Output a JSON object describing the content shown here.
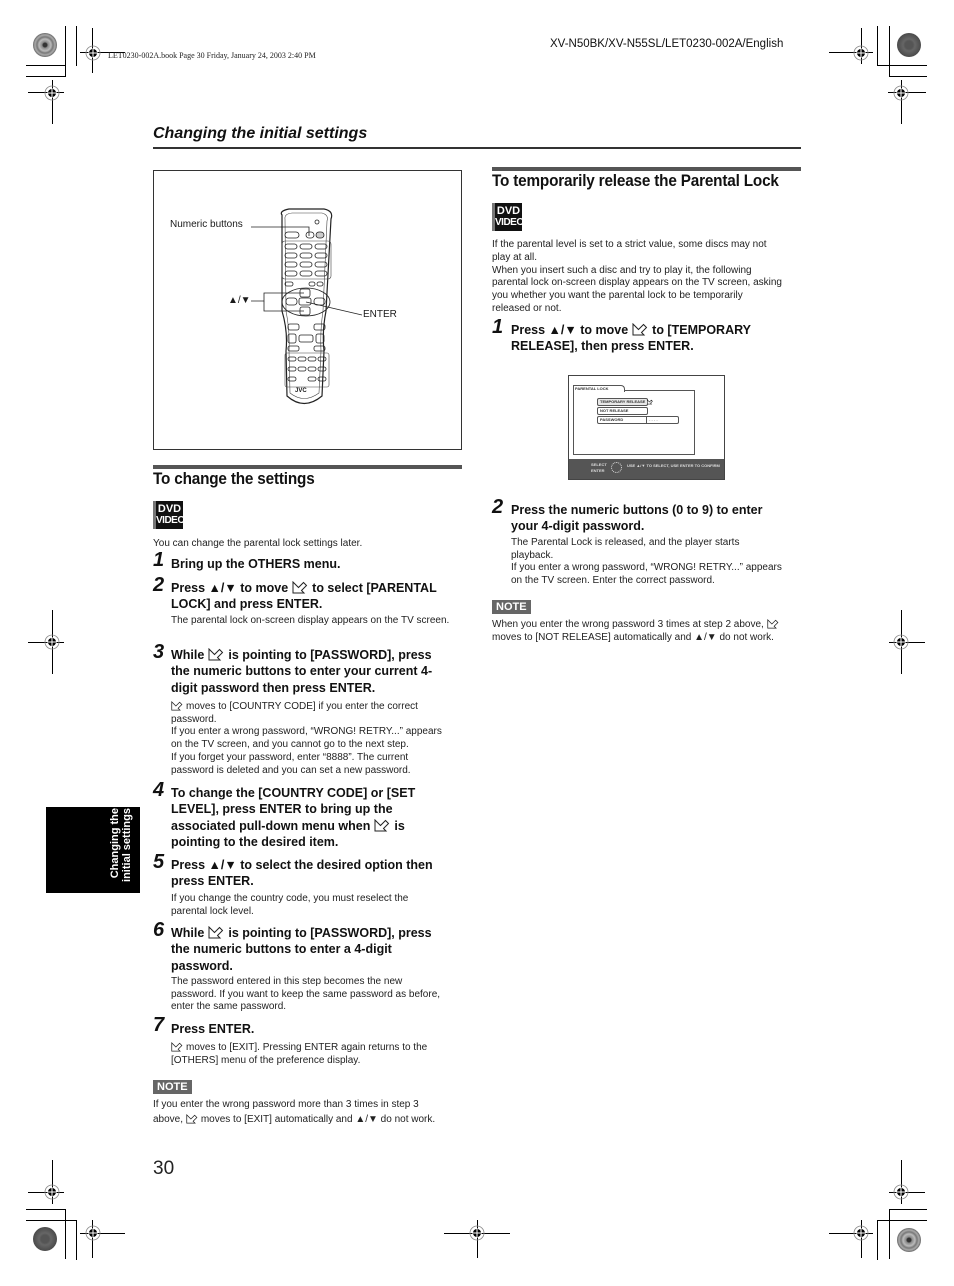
{
  "print_marks": {
    "book_info": "LET0230-002A.book  Page 30  Friday, January 24, 2003  2:40 PM",
    "model_line": "XV-N50BK/XV-N55SL/LET0230-002A/English"
  },
  "header": {
    "section_title": "Changing the initial settings"
  },
  "side_tab": {
    "line1": "Changing the",
    "line2": "initial settings"
  },
  "figure": {
    "label_numeric": "Numeric buttons",
    "label_arrows": "▲/▼",
    "label_enter": "ENTER",
    "brand": "JVC"
  },
  "badge": {
    "line1": "DVD",
    "line2": "VIDEO"
  },
  "left": {
    "title": "To change the settings",
    "intro": "You can change the parental lock settings later.",
    "steps": [
      {
        "num": "1",
        "text": "Bring up the OTHERS menu."
      },
      {
        "num": "2",
        "text_a": "Press ▲/▼ to move",
        "text_b": "to select [PARENTAL",
        "text_c": "LOCK] and press ENTER.",
        "desc": "The parental lock on-screen display appears on the TV screen."
      },
      {
        "num": "3",
        "text_a": "While",
        "text_b": "is pointing to [PASSWORD], press",
        "text_c": "the numeric buttons to enter your current 4-",
        "text_d": "digit password then press ENTER.",
        "desc1": "moves to [COUNTRY CODE] if you enter the correct",
        "desc1b": "password.",
        "desc2": "If you enter a wrong password, “WRONG! RETRY...” appears",
        "desc3": "on the TV screen, and you cannot go to the next step.",
        "desc4": "If you forget your password, enter “8888”. The current",
        "desc5": "password is deleted and you can set a new password."
      },
      {
        "num": "4",
        "text_a": "To change the [COUNTRY CODE] or [SET",
        "text_b": "LEVEL], press ENTER to bring up the",
        "text_c": "associated pull-down menu when",
        "text_d": "is",
        "text_e": "pointing to the desired item."
      },
      {
        "num": "5",
        "text_a": "Press ▲/▼ to select the desired option then",
        "text_b": "press ENTER.",
        "desc1": "If you change the country code, you must reselect the",
        "desc2": "parental lock level."
      },
      {
        "num": "6",
        "text_a": "While",
        "text_b": "is pointing to [PASSWORD], press",
        "text_c": "the numeric buttons to enter a 4-digit",
        "text_d": "password.",
        "desc1": "The password entered in this step becomes the new",
        "desc2": "password. If you want to keep the same password as before,",
        "desc3": "enter the same password."
      },
      {
        "num": "7",
        "text": "Press ENTER.",
        "desc1": "moves to [EXIT]. Pressing ENTER again returns to the",
        "desc2": "[OTHERS] menu of the preference display."
      }
    ],
    "note_label": "NOTE",
    "note_line1": "If you enter the wrong password more than 3 times in step 3",
    "note_line2a": "above,",
    "note_line2b": "moves to [EXIT] automatically and ▲/▼ do not work."
  },
  "right": {
    "title": "To temporarily release the Parental Lock",
    "intro1": "If the parental level is set to a strict value, some discs may not",
    "intro2": "play at all.",
    "intro3": "When you insert such a disc and try to play it, the following",
    "intro4": "parental lock on-screen display appears on the TV screen, asking",
    "intro5": "you whether you want the parental lock to be temporarily",
    "intro6": "released or not.",
    "steps": [
      {
        "num": "1",
        "text_a": "Press ▲/▼ to move",
        "text_b": "to [TEMPORARY",
        "text_c": "RELEASE], then press ENTER."
      },
      {
        "num": "2",
        "text_a": "Press the numeric buttons (0 to 9) to enter",
        "text_b": "your 4-digit password.",
        "desc1": "The Parental Lock is released, and the player starts",
        "desc2": "playback.",
        "desc3": "If you enter a wrong password, “WRONG! RETRY...” appears",
        "desc4": "on the TV screen. Enter the correct password."
      }
    ],
    "osd": {
      "tab": "PARENTAL LOCK",
      "items": [
        "TEMPORARY RELEASE",
        "NOT RELEASE",
        "PASSWORD"
      ],
      "password_value": "- - - -",
      "footer_select": "SELECT",
      "footer_enter": "ENTER",
      "footer_hint": "USE ▲/▼ TO SELECT, USE ENTER TO CONFIRM"
    },
    "note_label": "NOTE",
    "note_line1a": "When you enter the wrong password 3 times at step 2 above,",
    "note_line2": "moves to [NOT RELEASE] automatically and ▲/▼ do not work."
  },
  "footer": {
    "page_number": "30"
  }
}
